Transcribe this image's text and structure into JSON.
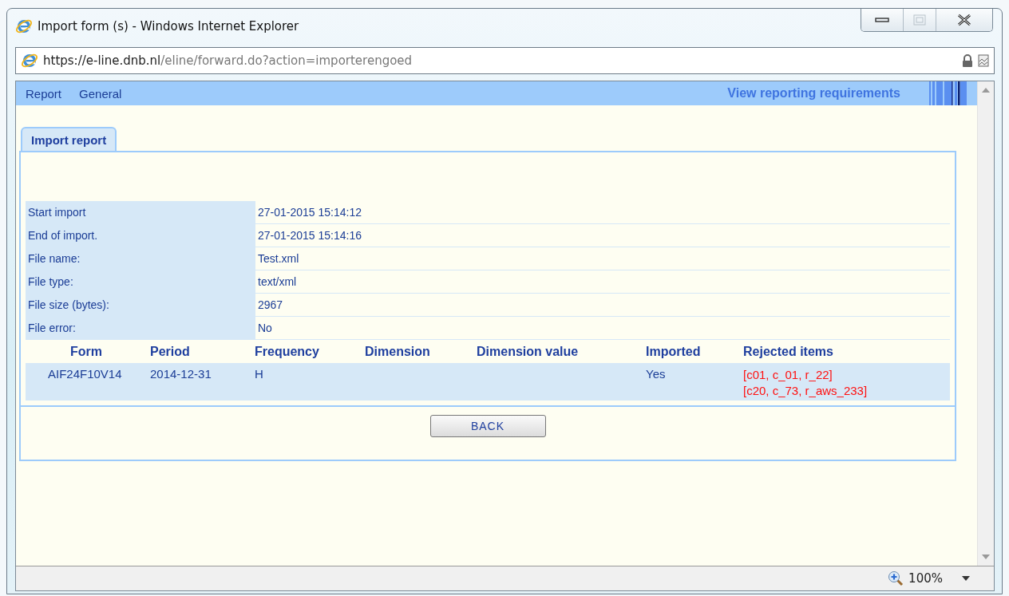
{
  "window": {
    "title": "Import form (s) - Windows Internet Explorer"
  },
  "address": {
    "host": "https://e-line.dnb.nl",
    "path": "/eline/forward.do?action=importerengoed"
  },
  "menu": {
    "items": [
      "Report",
      "General"
    ],
    "link": "View reporting requirements"
  },
  "tabs": [
    {
      "label": "Import report",
      "selected": true
    }
  ],
  "info": [
    {
      "label": "Start import",
      "value": "27-01-2015 15:14:12"
    },
    {
      "label": "End of import.",
      "value": "27-01-2015 15:14:16"
    },
    {
      "label": "File name:",
      "value": "Test.xml"
    },
    {
      "label": "File type:",
      "value": "text/xml"
    },
    {
      "label": "File size (bytes):",
      "value": "2967"
    },
    {
      "label": "File error:",
      "value": "No"
    }
  ],
  "table": {
    "columns": [
      "Form",
      "Period",
      "Frequency",
      "Dimension",
      "Dimension value",
      "Imported",
      "Rejected items"
    ],
    "rows": [
      {
        "cells": [
          "AIF24F10V14",
          "2014-12-31",
          "H",
          "",
          "",
          "Yes"
        ],
        "rejected": [
          "[c01, c_01, r_22]",
          "[c20, c_73, r_aws_233]"
        ]
      }
    ]
  },
  "back_button": "BACK",
  "status_bar": {
    "zoom": "100%"
  }
}
